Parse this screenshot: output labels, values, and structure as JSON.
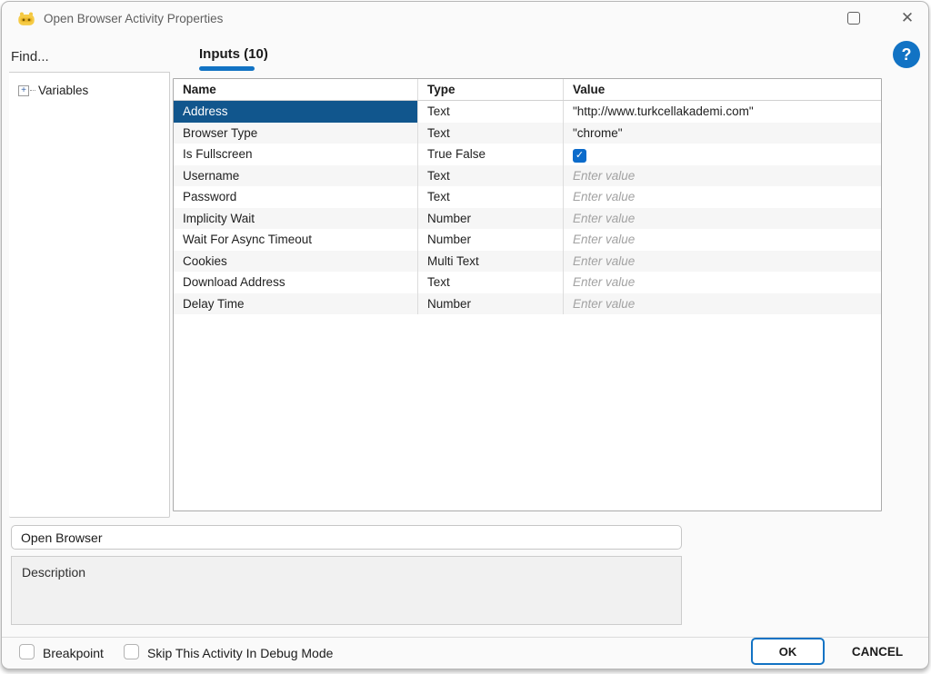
{
  "colors": {
    "accent": "#1273c4",
    "selection": "#11568d",
    "checkbox": "#0b6bcb",
    "row-alt": "#f6f6f6",
    "placeholder": "#a2a2a2"
  },
  "window": {
    "title": "Open Browser Activity Properties"
  },
  "sidebar": {
    "find_label": "Find...",
    "tree": {
      "expander_glyph": "+",
      "items": [
        {
          "label": "Variables"
        }
      ]
    }
  },
  "main": {
    "tab_label": "Inputs (10)",
    "help_label": "?"
  },
  "table": {
    "columns": [
      "Name",
      "Type",
      "Value"
    ],
    "rows": [
      {
        "name": "Address",
        "type": "Text",
        "value": "\"http://www.turkcellakademi.com\"",
        "kind": "text",
        "selected": true
      },
      {
        "name": "Browser Type",
        "type": "Text",
        "value": "\"chrome\"",
        "kind": "text"
      },
      {
        "name": "Is Fullscreen",
        "type": "True False",
        "kind": "checkbox",
        "checked": true,
        "check_glyph": "✓"
      },
      {
        "name": "Username",
        "type": "Text",
        "value": "Enter value",
        "kind": "placeholder"
      },
      {
        "name": "Password",
        "type": "Text",
        "value": "Enter value",
        "kind": "placeholder"
      },
      {
        "name": "Implicity Wait",
        "type": "Number",
        "value": "Enter value",
        "kind": "placeholder"
      },
      {
        "name": "Wait For Async Timeout",
        "type": "Number",
        "value": "Enter value",
        "kind": "placeholder"
      },
      {
        "name": "Cookies",
        "type": "Multi Text",
        "value": "Enter value",
        "kind": "placeholder"
      },
      {
        "name": "Download Address",
        "type": "Text",
        "value": "Enter value",
        "kind": "placeholder"
      },
      {
        "name": "Delay Time",
        "type": "Number",
        "value": "Enter value",
        "kind": "placeholder"
      }
    ]
  },
  "activity": {
    "name_value": "Open Browser",
    "description_label": "Description"
  },
  "footer": {
    "breakpoint_label": "Breakpoint",
    "skip_label": "Skip This Activity In Debug Mode",
    "ok_label": "OK",
    "cancel_label": "CANCEL"
  }
}
